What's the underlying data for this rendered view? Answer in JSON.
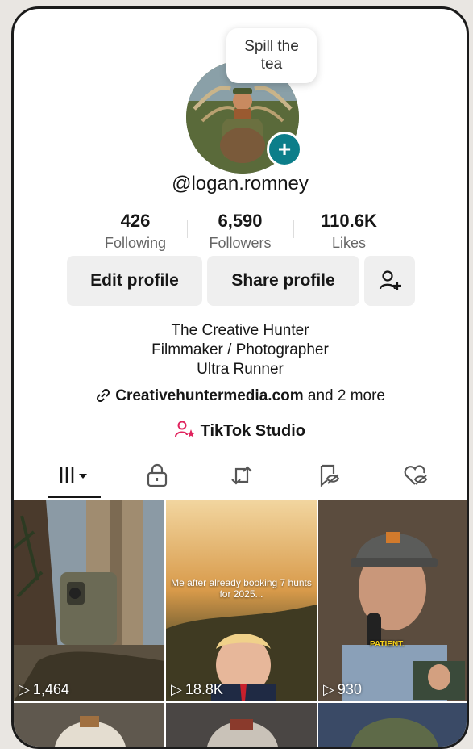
{
  "profile": {
    "bubble_text": "Spill the\ntea",
    "handle": "@logan.romney",
    "avatar_icon": "avatar-photo",
    "add_icon": "plus-icon"
  },
  "stats": [
    {
      "value": "426",
      "label": "Following"
    },
    {
      "value": "6,590",
      "label": "Followers"
    },
    {
      "value": "110.6K",
      "label": "Likes"
    }
  ],
  "actions": {
    "edit_label": "Edit profile",
    "share_label": "Share profile",
    "add_friend_icon": "add-user-icon"
  },
  "bio": {
    "lines": [
      "The Creative Hunter",
      "Filmmaker / Photographer",
      "Ultra Runner"
    ],
    "link_text": "Creativehuntermedia.com",
    "link_more": "and 2 more",
    "studio_label": "TikTok Studio"
  },
  "tabs": [
    {
      "name": "videos",
      "icon": "grid-icon",
      "active": true
    },
    {
      "name": "private",
      "icon": "lock-icon"
    },
    {
      "name": "reposts",
      "icon": "repost-icon"
    },
    {
      "name": "favorites",
      "icon": "bookmark-hidden-icon"
    },
    {
      "name": "liked",
      "icon": "heart-hidden-icon"
    }
  ],
  "videos": [
    {
      "views": "1,464",
      "caption": ""
    },
    {
      "views": "18.8K",
      "caption": "Me after already booking 7 hunts\nfor 2025..."
    },
    {
      "views": "930",
      "caption": "PATIENT."
    }
  ],
  "colors": {
    "accent": "#0c7e8a",
    "studio_icon": "#e0245e"
  }
}
